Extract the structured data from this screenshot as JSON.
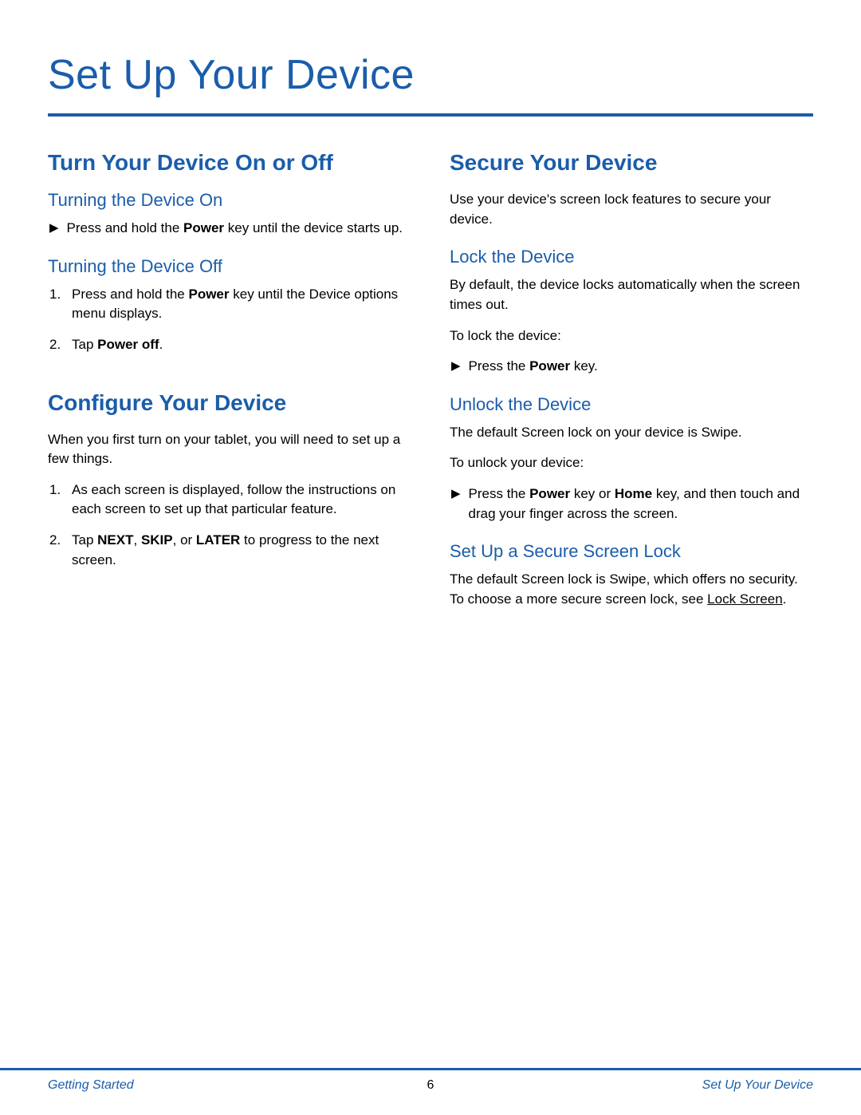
{
  "title": "Set Up Your Device",
  "left": {
    "section1": {
      "heading": "Turn Your Device On or Off",
      "sub1": {
        "heading": "Turning the Device On",
        "bullet_html": "Press and hold the <strong>Power</strong> key until the device starts up."
      },
      "sub2": {
        "heading": "Turning the Device Off",
        "item1_html": "Press and hold the <strong>Power</strong> key until the Device options menu displays.",
        "item2_html": "Tap <strong>Power off</strong>."
      }
    },
    "section2": {
      "heading": "Configure Your Device",
      "intro": "When you first turn on your tablet, you will need to set up a few things.",
      "item1": "As each screen is displayed, follow the instructions on each screen to set up that particular feature.",
      "item2_html": "Tap <strong>NEXT</strong>, <strong>SKIP</strong>, or <strong>LATER</strong> to progress to the next screen."
    }
  },
  "right": {
    "section1": {
      "heading": "Secure Your Device",
      "intro": "Use your device's screen lock features to secure your device.",
      "sub1": {
        "heading": "Lock the Device",
        "p1": "By default, the device locks automatically when the screen times out.",
        "p2": "To lock the device:",
        "bullet_html": "Press the <strong>Power</strong> key."
      },
      "sub2": {
        "heading": "Unlock the Device",
        "p1": "The default Screen lock on your device is Swipe.",
        "p2": "To unlock your device:",
        "bullet_html": "Press the <strong>Power</strong> key or <strong>Home</strong> key, and then touch and drag your finger across the screen."
      },
      "sub3": {
        "heading": "Set Up a Secure Screen Lock",
        "p1_prefix": "The default Screen lock is Swipe, which offers no security. To choose a more secure screen lock, see ",
        "link_text": "Lock Screen",
        "p1_suffix": "."
      }
    }
  },
  "footer": {
    "left": "Getting Started",
    "center": "6",
    "right": "Set Up Your Device"
  }
}
